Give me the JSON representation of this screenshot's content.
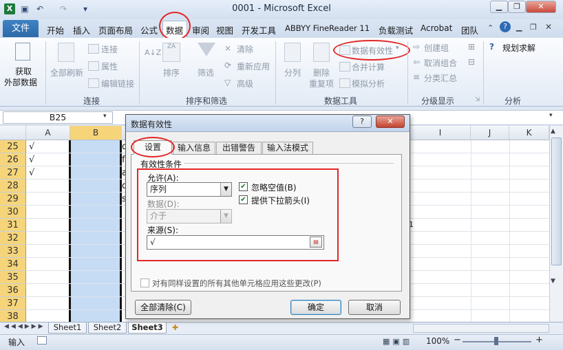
{
  "window": {
    "title": "0001 - Microsoft Excel",
    "controls": [
      "▁",
      "❐",
      "✕"
    ]
  },
  "ribbon_tabs": {
    "file": "文件",
    "tabs": [
      "开始",
      "插入",
      "页面布局",
      "公式",
      "数据",
      "审阅",
      "视图",
      "开发工具",
      "ABBYY FineReader 11",
      "负载测试",
      "Acrobat",
      "团队"
    ],
    "active": "数据"
  },
  "ribbon": {
    "get_external": {
      "line1": "获取",
      "line2": "外部数据"
    },
    "refresh_all": "全部刷新",
    "connections": "连接",
    "properties": "属性",
    "edit_links": "编辑链接",
    "group_connections": "连接",
    "sort": "排序",
    "filter": "筛选",
    "clear": "清除",
    "reapply": "重新应用",
    "advanced": "高级",
    "group_sort_filter": "排序和筛选",
    "split": "分列",
    "remove_dup_line1": "删除",
    "remove_dup_line2": "重复项",
    "data_validation": "数据有效性",
    "consolidate": "合并计算",
    "what_if": "模拟分析",
    "group_data_tools": "数据工具",
    "group_outline_create": "创建组",
    "ungroup": "取消组合",
    "subtotal": "分类汇总",
    "group_outline": "分级显示",
    "solver": "规划求解",
    "group_analysis": "分析"
  },
  "name_box": "B25",
  "columns": {
    "A": "A",
    "B": "B",
    "I": "I",
    "J": "J",
    "K": "K"
  },
  "rows": [
    {
      "num": "25",
      "a": "√",
      "c": "d"
    },
    {
      "num": "26",
      "a": "√",
      "c": "f"
    },
    {
      "num": "27",
      "a": "√",
      "c": "a"
    },
    {
      "num": "28",
      "a": "",
      "c": "d"
    },
    {
      "num": "29",
      "a": "",
      "c": "s"
    },
    {
      "num": "30",
      "a": "",
      "c": ""
    },
    {
      "num": "31",
      "a": "",
      "c": ""
    },
    {
      "num": "32",
      "a": "",
      "c": ""
    },
    {
      "num": "33",
      "a": "",
      "c": ""
    },
    {
      "num": "34",
      "a": "",
      "c": ""
    },
    {
      "num": "35",
      "a": "",
      "c": ""
    },
    {
      "num": "36",
      "a": "",
      "c": ""
    },
    {
      "num": "37",
      "a": "",
      "c": ""
    },
    {
      "num": "38",
      "a": "",
      "c": ""
    }
  ],
  "row31_h_value": "1",
  "sheets": [
    "Sheet1",
    "Sheet2",
    "Sheet3"
  ],
  "status": {
    "mode": "输入",
    "zoom": "100%",
    "zoom_minus": "−",
    "zoom_plus": "+"
  },
  "dialog": {
    "title": "数据有效性",
    "help": "?",
    "close": "✕",
    "tabs": [
      "设置",
      "输入信息",
      "出错警告",
      "输入法模式"
    ],
    "section": "有效性条件",
    "allow_label": "允许(A):",
    "allow_value": "序列",
    "ignore_blank": "忽略空值(B)",
    "dropdown": "提供下拉箭头(I)",
    "data_label": "数据(D):",
    "data_value": "介于",
    "source_label": "来源(S):",
    "source_value": "√",
    "apply_all": "对有同样设置的所有其他单元格应用这些更改(P)",
    "clear_all": "全部清除(C)",
    "ok": "确定",
    "cancel": "取消"
  },
  "colors": {
    "accent_red": "#e32626",
    "selection": "#c6dcf5",
    "file_tab": "#2d6aa8"
  }
}
